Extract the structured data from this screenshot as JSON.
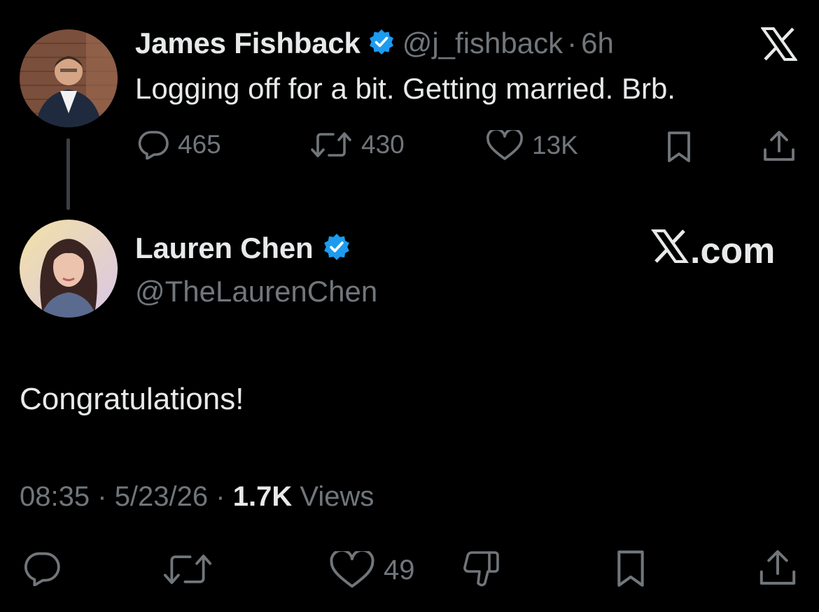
{
  "colors": {
    "background": "#000000",
    "text_primary": "#e7e9ea",
    "text_secondary": "#71767b",
    "verified_blue": "#1d9bf0"
  },
  "original_post": {
    "author_name": "James Fishback",
    "handle": "@j_fishback",
    "separator": "·",
    "time": "6h",
    "text": "Logging off for a bit. Getting married. Brb.",
    "replies": "465",
    "reposts": "430",
    "likes": "13K",
    "corner_icon": "x-logo-icon"
  },
  "reply_post": {
    "author_name": "Lauren Chen",
    "handle": "@TheLaurenChen",
    "brand_suffix": ".com",
    "text": "Congratulations!",
    "time": "08:35",
    "date": "5/23/26",
    "separator": "·",
    "views_count": "1.7K",
    "views_label": "Views",
    "likes": "49"
  }
}
